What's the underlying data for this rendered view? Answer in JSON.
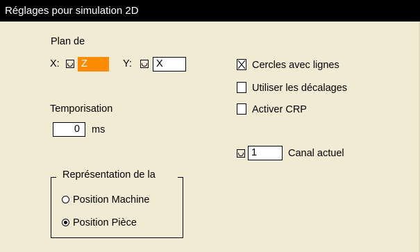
{
  "window": {
    "title": "Réglages pour simulation 2D"
  },
  "plan": {
    "title": "Plan de",
    "x_label": "X:",
    "x_value": "Z",
    "y_label": "Y:",
    "y_value": "X"
  },
  "temporisation": {
    "title": "Temporisation",
    "value": "0",
    "unit": "ms"
  },
  "options": {
    "cercles_avec_lignes": {
      "label": "Cercles avec lignes",
      "checked": true
    },
    "utiliser_decalages": {
      "label": "Utiliser les décalages",
      "checked": false
    },
    "activer_crp": {
      "label": "Activer CRP",
      "checked": false
    }
  },
  "canal": {
    "value": "1",
    "label": "Canal actuel"
  },
  "representation": {
    "title": "Représentation de la",
    "options": [
      {
        "label": "Position Machine",
        "selected": false
      },
      {
        "label": "Position Pièce",
        "selected": true
      }
    ]
  },
  "colors": {
    "background": "#f1ebd4",
    "title_background": "#000000",
    "title_text": "#ffffff",
    "active_field": "#ff8c00"
  },
  "icons": {
    "selector": "selector-icon",
    "checked": "check-x-icon"
  }
}
